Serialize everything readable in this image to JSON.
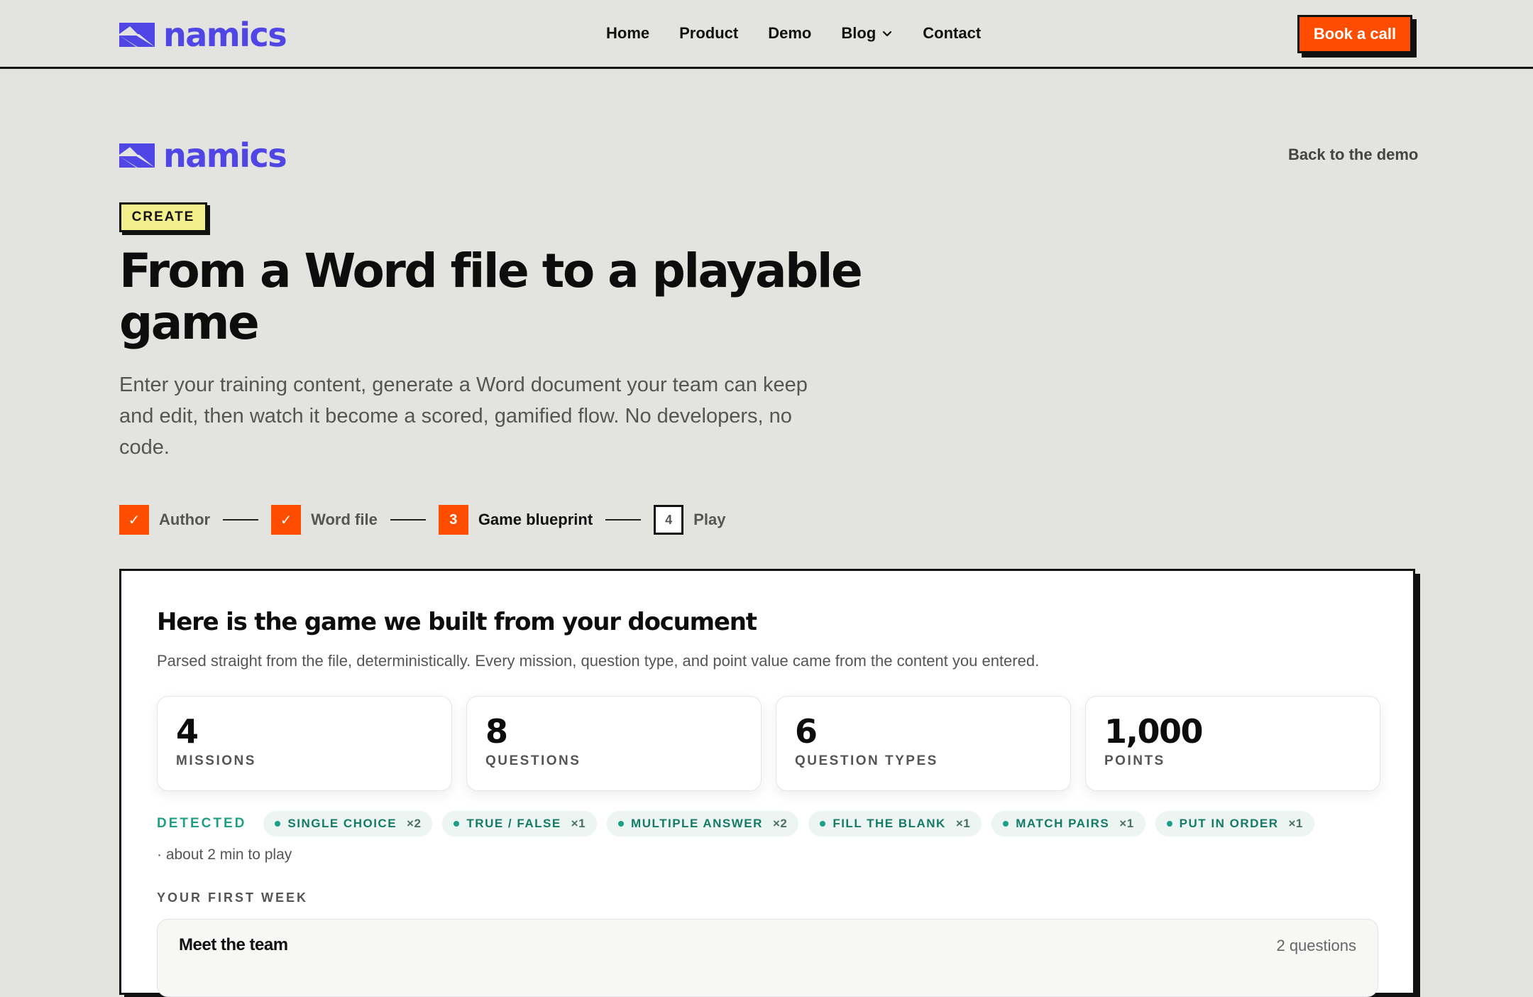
{
  "brand": {
    "name": "namics",
    "color": "#4f46e5"
  },
  "nav": {
    "links": [
      {
        "label": "Home"
      },
      {
        "label": "Product"
      },
      {
        "label": "Demo"
      },
      {
        "label": "Blog",
        "has_dropdown": true
      },
      {
        "label": "Contact"
      }
    ],
    "cta_label": "Book a call",
    "cta_color": "#ff4d00"
  },
  "hero": {
    "back_label": "Back to the demo",
    "badge": "CREATE",
    "title": "From a Word file to a playable game",
    "subtitle": "Enter your training content, generate a Word document your team can keep and edit, then watch it become a scored, gamified flow. No developers, no code."
  },
  "stepper": {
    "steps": [
      {
        "marker": "✓",
        "label": "Author",
        "state": "done"
      },
      {
        "marker": "✓",
        "label": "Word file",
        "state": "done"
      },
      {
        "marker": "3",
        "label": "Game blueprint",
        "state": "current"
      },
      {
        "marker": "4",
        "label": "Play",
        "state": "todo"
      }
    ]
  },
  "card": {
    "title": "Here is the game we built from your document",
    "subtitle": "Parsed straight from the file, deterministically. Every mission, question type, and point value came from the content you entered.",
    "stats": [
      {
        "value": "4",
        "label": "MISSIONS"
      },
      {
        "value": "8",
        "label": "QUESTIONS"
      },
      {
        "value": "6",
        "label": "QUESTION TYPES"
      },
      {
        "value": "1,000",
        "label": "POINTS"
      }
    ],
    "detected_label": "DETECTED",
    "chips": [
      {
        "label": "SINGLE CHOICE",
        "count": "×2"
      },
      {
        "label": "TRUE / FALSE",
        "count": "×1"
      },
      {
        "label": "MULTIPLE ANSWER",
        "count": "×2"
      },
      {
        "label": "FILL THE BLANK",
        "count": "×1"
      },
      {
        "label": "MATCH PAIRS",
        "count": "×1"
      },
      {
        "label": "PUT IN ORDER",
        "count": "×1"
      }
    ],
    "duration": "· about 2 min to play",
    "section_label": "YOUR FIRST WEEK",
    "missions": [
      {
        "title": "Meet the team",
        "count": "2 questions"
      }
    ]
  }
}
